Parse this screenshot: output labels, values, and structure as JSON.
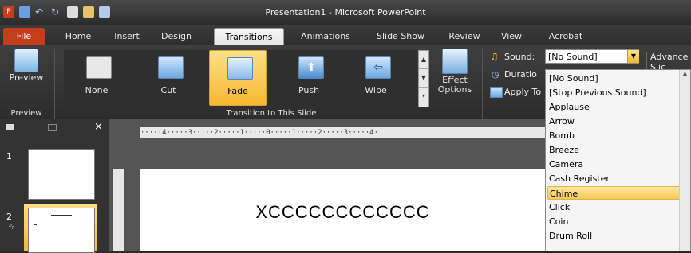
{
  "window": {
    "title": "Presentation1 - Microsoft PowerPoint"
  },
  "tabs": [
    "File",
    "Home",
    "Insert",
    "Design",
    "Transitions",
    "Animations",
    "Slide Show",
    "Review",
    "View",
    "Acrobat"
  ],
  "active_tab": "Transitions",
  "ribbon": {
    "preview_label": "Preview",
    "preview_group": "Preview",
    "transitions": [
      {
        "label": "None"
      },
      {
        "label": "Cut"
      },
      {
        "label": "Fade"
      },
      {
        "label": "Push"
      },
      {
        "label": "Wipe"
      }
    ],
    "selected_transition": "Fade",
    "effect_options": [
      "Effect",
      "Options"
    ],
    "transition_group": "Transition to This Slide",
    "sound_label": "Sound:",
    "sound_value": "[No Sound]",
    "advance_label": "Advance Slic",
    "duration_label": "Duratio",
    "apply_label": "Apply To"
  },
  "sound_options": [
    "[No Sound]",
    "[Stop Previous Sound]",
    "Applause",
    "Arrow",
    "Bomb",
    "Breeze",
    "Camera",
    "Cash Register",
    "Chime",
    "Click",
    "Coin",
    "Drum Roll"
  ],
  "highlighted_option": "Chime",
  "slides": [
    {
      "number": "1"
    },
    {
      "number": "2"
    }
  ],
  "ruler_text": "·····4·····3·····2·····1·····0·····1·····2·····3·····4·",
  "slide": {
    "title": "XCCCCCCCCCCCC"
  },
  "colors": {
    "file_tab": "#c43e1c",
    "selected_gold": "#f5b830",
    "ribbon_dark": "#2c2c2c"
  }
}
